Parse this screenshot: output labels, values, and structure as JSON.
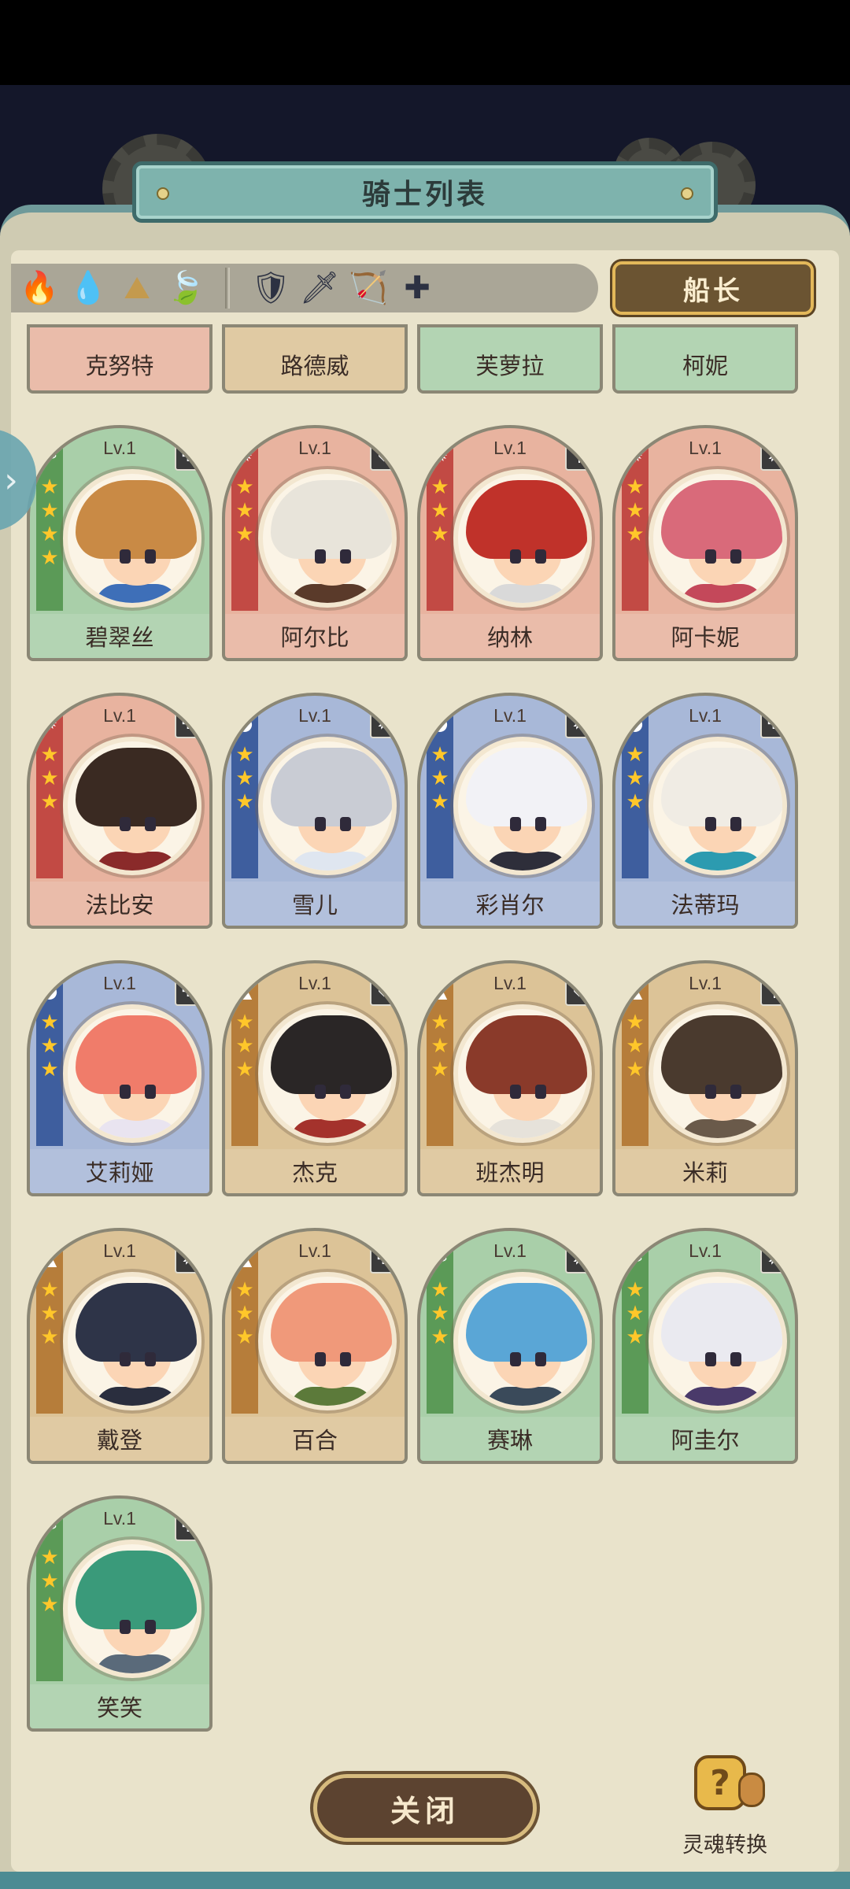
{
  "title": "骑士列表",
  "captain_label": "船长",
  "close_label": "关闭",
  "soul_convert_label": "灵魂转换",
  "soul_icon_glyph": "?",
  "side_tab_glyph": "›",
  "filters": {
    "elements": [
      {
        "name": "fire",
        "icon": "🔥",
        "color": "#b8404a"
      },
      {
        "name": "water",
        "icon": "💧",
        "color": "#4f6fb5"
      },
      {
        "name": "earth",
        "icon": "⛰",
        "color": "#c49a4e"
      },
      {
        "name": "wind",
        "icon": "🍃",
        "color": "#6fae5e"
      }
    ],
    "roles": [
      {
        "name": "shield",
        "icon": "🛡"
      },
      {
        "name": "sword",
        "icon": "🗡"
      },
      {
        "name": "bow",
        "icon": "🏹"
      },
      {
        "name": "healer",
        "icon": "✚"
      }
    ]
  },
  "partial_row": [
    {
      "name": "克努特",
      "element": "fire"
    },
    {
      "name": "路德威",
      "element": "earth"
    },
    {
      "name": "芙萝拉",
      "element": "wind"
    },
    {
      "name": "柯妮",
      "element": "wind"
    }
  ],
  "knights": [
    {
      "name": "碧翠丝",
      "level": "Lv.1",
      "element": "wind",
      "role": "healer",
      "stars": 4,
      "hair": "#c98a45",
      "outfit": "#3e6fb8"
    },
    {
      "name": "阿尔比",
      "level": "Lv.1",
      "element": "fire",
      "role": "shield",
      "stars": 3,
      "hair": "#e8e4da",
      "outfit": "#5a3a2a"
    },
    {
      "name": "纳林",
      "level": "Lv.1",
      "element": "fire",
      "role": "sword",
      "stars": 3,
      "hair": "#c0322a",
      "outfit": "#d9d9d9"
    },
    {
      "name": "阿卡妮",
      "level": "Lv.1",
      "element": "fire",
      "role": "bow",
      "stars": 3,
      "hair": "#d96a7a",
      "outfit": "#c4485a"
    },
    {
      "name": "法比安",
      "level": "Lv.1",
      "element": "fire",
      "role": "healer",
      "stars": 3,
      "hair": "#3a2a22",
      "outfit": "#8a2a2a"
    },
    {
      "name": "雪儿",
      "level": "Lv.1",
      "element": "water",
      "role": "bow",
      "stars": 3,
      "hair": "#c9ccd4",
      "outfit": "#dfe6f0"
    },
    {
      "name": "彩肖尔",
      "level": "Lv.1",
      "element": "water",
      "role": "bow",
      "stars": 3,
      "hair": "#f2f2f6",
      "outfit": "#2e2e3a"
    },
    {
      "name": "法蒂玛",
      "level": "Lv.1",
      "element": "water",
      "role": "healer",
      "stars": 3,
      "hair": "#f0ece4",
      "outfit": "#2c9bb0"
    },
    {
      "name": "艾莉娅",
      "level": "Lv.1",
      "element": "water",
      "role": "healer",
      "stars": 3,
      "hair": "#f07c6a",
      "outfit": "#e9e4f0"
    },
    {
      "name": "杰克",
      "level": "Lv.1",
      "element": "earth",
      "role": "shield",
      "stars": 3,
      "hair": "#2a2626",
      "outfit": "#a4322c"
    },
    {
      "name": "班杰明",
      "level": "Lv.1",
      "element": "earth",
      "role": "shield",
      "stars": 3,
      "hair": "#8a3a2a",
      "outfit": "#e6e2da"
    },
    {
      "name": "米莉",
      "level": "Lv.1",
      "element": "earth",
      "role": "sword",
      "stars": 3,
      "hair": "#4a3a2e",
      "outfit": "#6a5a4a"
    },
    {
      "name": "戴登",
      "level": "Lv.1",
      "element": "earth",
      "role": "bow",
      "stars": 3,
      "hair": "#2e3448",
      "outfit": "#2a2e3e"
    },
    {
      "name": "百合",
      "level": "Lv.1",
      "element": "earth",
      "role": "healer",
      "stars": 3,
      "hair": "#f0997a",
      "outfit": "#5c7a3a"
    },
    {
      "name": "赛琳",
      "level": "Lv.1",
      "element": "wind",
      "role": "bow",
      "stars": 3,
      "hair": "#5aa6d6",
      "outfit": "#3a4a5a"
    },
    {
      "name": "阿圭尔",
      "level": "Lv.1",
      "element": "wind",
      "role": "bow",
      "stars": 3,
      "hair": "#eaeaf0",
      "outfit": "#4a3a6a"
    },
    {
      "name": "笑笑",
      "level": "Lv.1",
      "element": "wind",
      "role": "healer",
      "stars": 3,
      "hair": "#3a9a7a",
      "outfit": "#5a6a7a"
    }
  ],
  "element_glyphs": {
    "fire": "✹",
    "water": "●",
    "earth": "▲",
    "wind": "❧"
  },
  "role_glyphs": {
    "shield": "⛨",
    "sword": "†",
    "bow": "➶",
    "healer": "✚"
  },
  "star_glyph": "★"
}
